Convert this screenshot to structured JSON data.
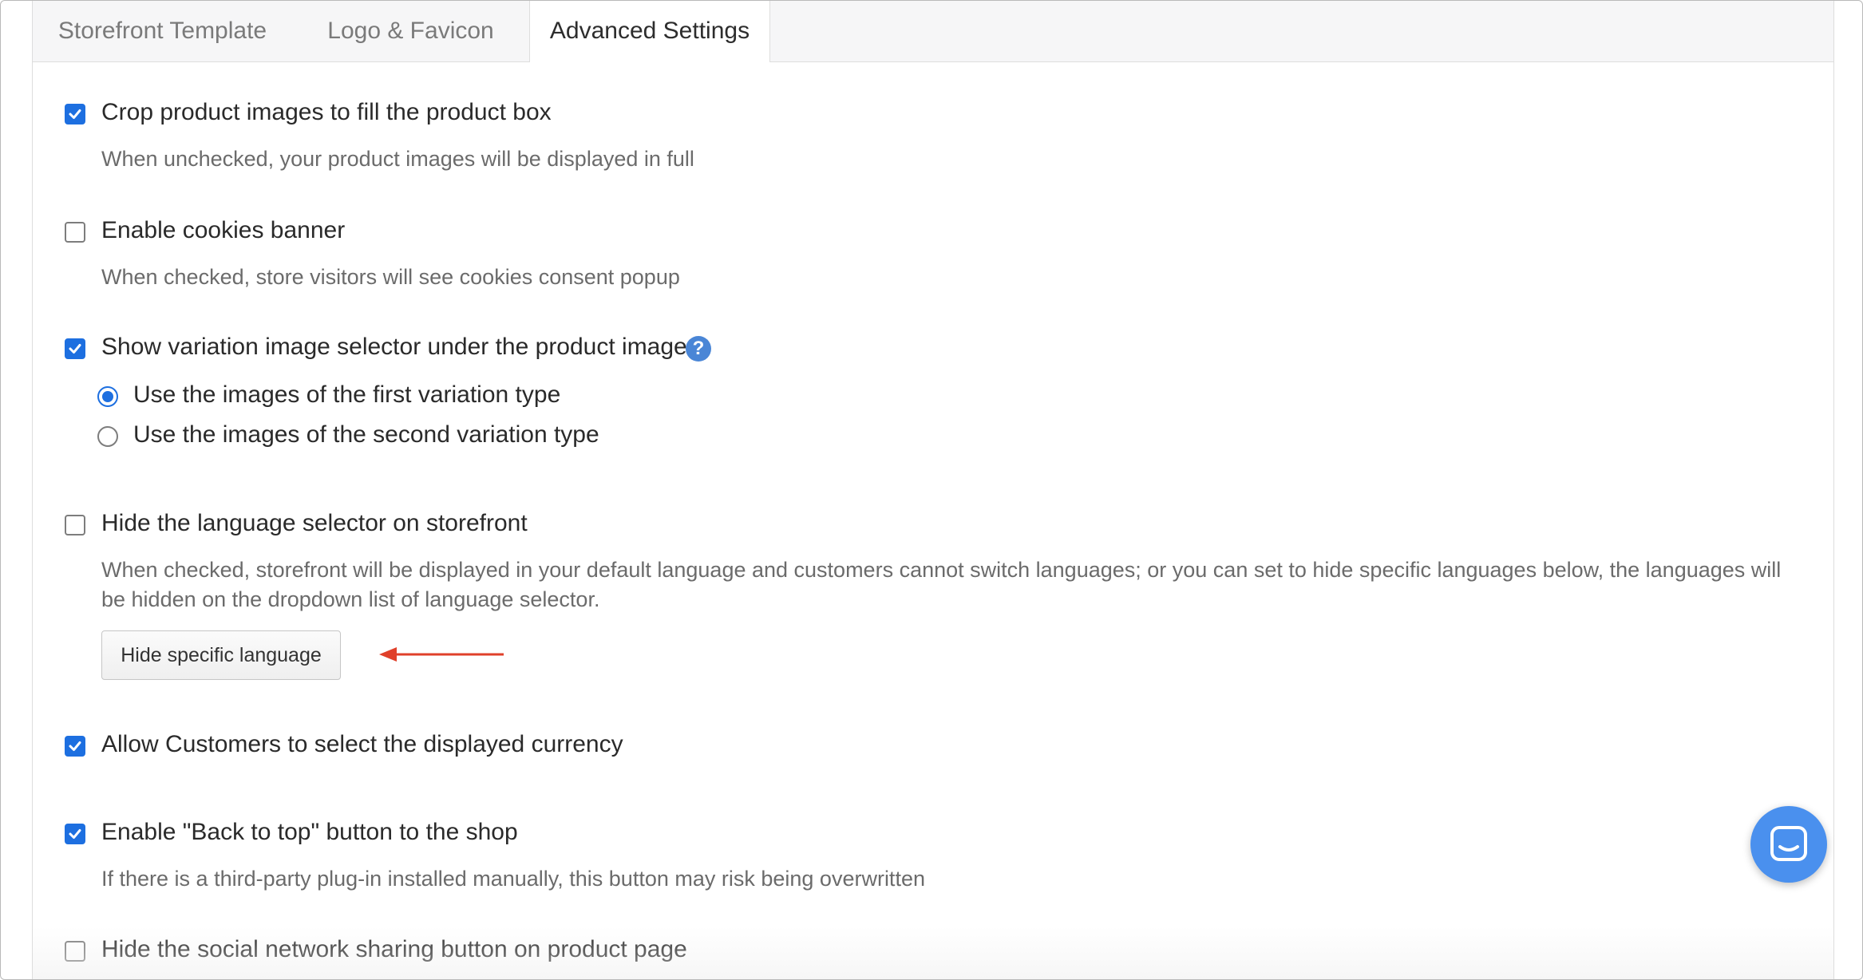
{
  "tabs": [
    {
      "label": "Storefront Template",
      "active": false
    },
    {
      "label": "Logo & Favicon",
      "active": false
    },
    {
      "label": "Advanced Settings",
      "active": true
    }
  ],
  "settings": {
    "crop_images": {
      "label": "Crop product images to fill the product box",
      "description": "When unchecked, your product images will be displayed in full",
      "checked": true
    },
    "cookies_banner": {
      "label": "Enable cookies banner",
      "description": "When checked, store visitors will see cookies consent popup",
      "checked": false
    },
    "variation_selector": {
      "label": "Show variation image selector under the product image",
      "checked": true,
      "help_icon": "question-circle-icon",
      "options": [
        {
          "label": "Use the images of the first variation type",
          "selected": true
        },
        {
          "label": "Use the images of the second variation type",
          "selected": false
        }
      ]
    },
    "hide_language": {
      "label": "Hide the language selector on storefront",
      "description_line1": "When checked, storefront will be displayed in your default language and customers cannot switch languages; or you can set to hide specific languages below, the languages will",
      "description_line2": "be hidden on the dropdown list of language selector.",
      "checked": false,
      "button_label": "Hide specific language"
    },
    "select_currency": {
      "label": "Allow Customers to select the displayed currency",
      "checked": true
    },
    "back_to_top": {
      "label": "Enable \"Back to top\" button to the shop",
      "description": "If there is a third-party plug-in installed manually, this button may risk being overwritten",
      "checked": true
    },
    "hide_social": {
      "label": "Hide the social network sharing button on product page",
      "checked": false
    }
  },
  "colors": {
    "accent": "#1d6fe0",
    "arrow": "#e0402a",
    "chat": "#4a90ee"
  },
  "chat_widget": {
    "icon": "chat-bubble-icon"
  }
}
